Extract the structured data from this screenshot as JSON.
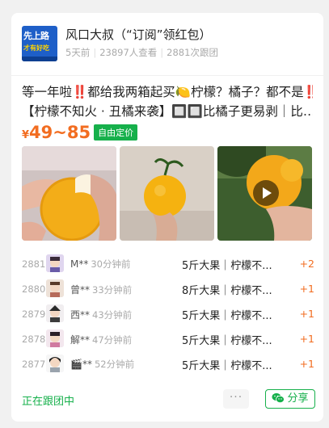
{
  "post": {
    "avatar_text_top": "先上路",
    "avatar_text_bottom": "才有好吃",
    "author": "风口大叔（“订阅”领红包）",
    "time": "5天前",
    "views": "23897人查看",
    "followers": "2881次跟团",
    "title_line1": "等一年啦‼️都给我两箱起买🍋柠檬？橘子？都不是‼️",
    "title_line2": "【柠檬不知火 · 丑橘来袭】🔲🔲比橘子更易剥｜比…",
    "price_symbol": "¥",
    "price_range": "49~85",
    "price_tag": "自由定价"
  },
  "orders": [
    {
      "no": "2881",
      "name": "M**",
      "time": "30分钟前",
      "product": "5斤大果｜柠檬不...",
      "qty": "+2"
    },
    {
      "no": "2880",
      "name": "曾**",
      "time": "33分钟前",
      "product": "8斤大果｜柠檬不...",
      "qty": "+1"
    },
    {
      "no": "2879",
      "name": "西**",
      "time": "43分钟前",
      "product": "5斤大果｜柠檬不...",
      "qty": "+1"
    },
    {
      "no": "2878",
      "name": "解**",
      "time": "47分钟前",
      "product": "5斤大果｜柠檬不...",
      "qty": "+1"
    },
    {
      "no": "2877",
      "name": "🎬**",
      "time": "52分钟前",
      "product": "5斤大果｜柠檬不...",
      "qty": "+1"
    }
  ],
  "footer": {
    "status": "正在跟团中",
    "more": "···",
    "share": "分享"
  },
  "colors": {
    "accent_green": "#16b04b",
    "price_orange": "#f26d21"
  }
}
